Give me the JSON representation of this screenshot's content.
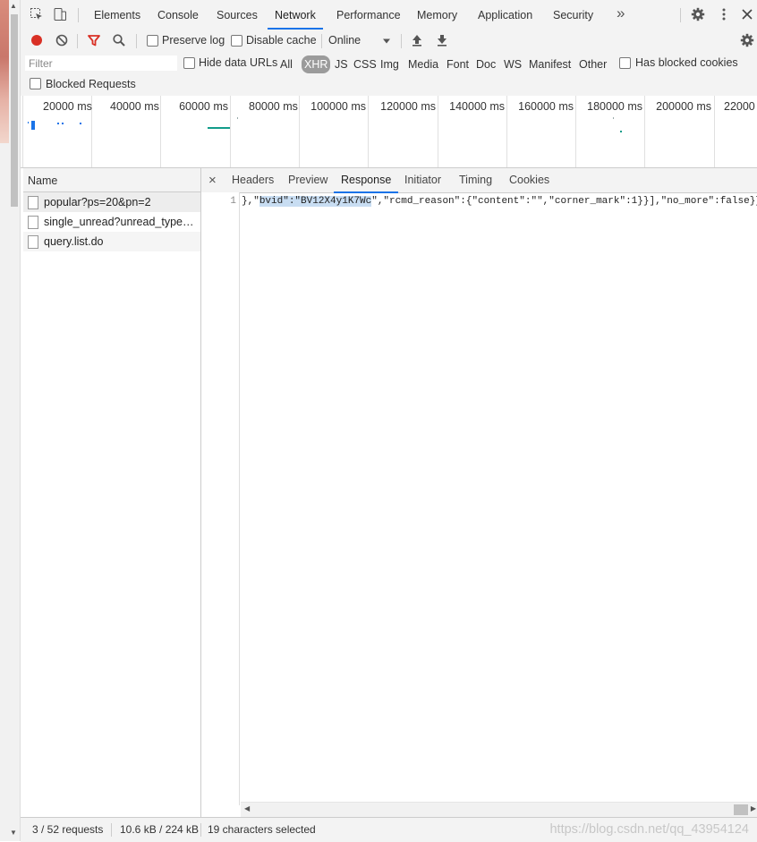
{
  "main_tabs": [
    "Elements",
    "Console",
    "Sources",
    "Network",
    "Performance",
    "Memory",
    "Application",
    "Security"
  ],
  "main_tabs_active": "Network",
  "overflow_label": "»",
  "toolbar": {
    "preserve_log": "Preserve log",
    "disable_cache": "Disable cache",
    "throttling": "Online"
  },
  "filter": {
    "placeholder": "Filter",
    "hide_data_urls": "Hide data URLs",
    "types": [
      "All",
      "XHR",
      "JS",
      "CSS",
      "Img",
      "Media",
      "Font",
      "Doc",
      "WS",
      "Manifest",
      "Other"
    ],
    "active_type": "XHR",
    "has_blocked_cookies": "Has blocked cookies",
    "blocked_requests": "Blocked Requests"
  },
  "overview": {
    "ticks": [
      "20000 ms",
      "40000 ms",
      "60000 ms",
      "80000 ms",
      "100000 ms",
      "120000 ms",
      "140000 ms",
      "160000 ms",
      "180000 ms",
      "200000 ms",
      "22000"
    ]
  },
  "requests": {
    "header": "Name",
    "items": [
      "popular?ps=20&pn=2",
      "single_unread?unread_type=0...",
      "query.list.do"
    ]
  },
  "details": {
    "close_symbol": "×",
    "tabs": [
      "Headers",
      "Preview",
      "Response",
      "Initiator",
      "Timing",
      "Cookies"
    ],
    "active_tab": "Response",
    "line_number": "1",
    "code_before": "},\"",
    "code_highlight": "bvid\":\"BV12X4y1K7Wc",
    "code_after": "\",\"rcmd_reason\":{\"content\":\"\",\"corner_mark\":1}}],\"no_more\":false}}"
  },
  "status": {
    "requests": "3 / 52 requests",
    "transferred": "10.6 kB / 224 kB",
    "selection": "19 characters selected",
    "watermark": "https://blog.csdn.net/qq_43954124"
  },
  "colors": {
    "accent": "#1a73e8",
    "record": "#d93025",
    "filter_icon": "#d93025",
    "selection_highlight": "#c8ddf2"
  }
}
